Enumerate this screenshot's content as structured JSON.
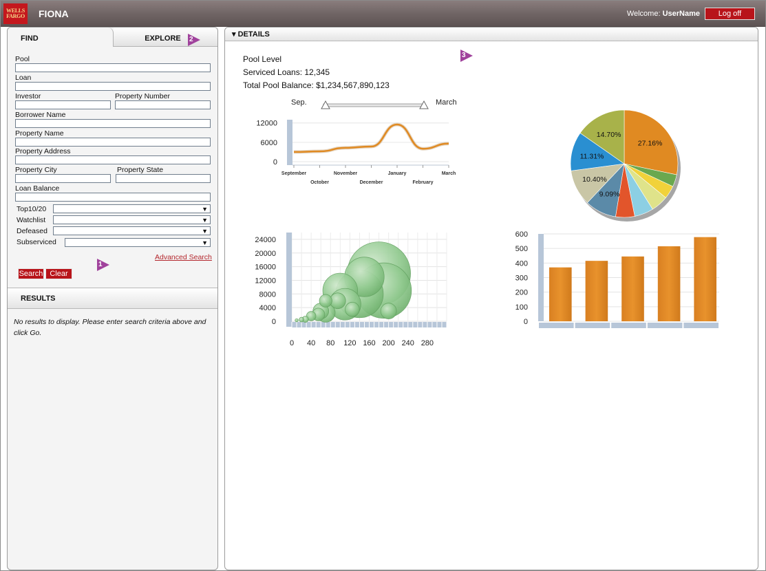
{
  "app": {
    "logo_text_1": "WELLS",
    "logo_text_2": "FARGO",
    "title": "FIONA",
    "welcome_label": "Welcome:",
    "username": "UserName",
    "logoff_label": "Log off"
  },
  "find": {
    "tab_find": "FIND",
    "tab_explore": "EXPLORE",
    "fields": {
      "pool": "Pool",
      "loan": "Loan",
      "investor": "Investor",
      "property_number": "Property Number",
      "borrower_name": "Borrower Name",
      "property_name": "Property Name",
      "property_address": "Property Address",
      "property_city": "Property City",
      "property_state": "Property State",
      "loan_balance": "Loan Balance",
      "top10_20": "Top10/20",
      "watchlist": "Watchlist",
      "defeased": "Defeased",
      "subserviced": "Subserviced"
    },
    "advanced_search": "Advanced Search",
    "search_btn": "Search",
    "clear_btn": "Clear",
    "results_title": "RESULTS",
    "results_message": "No results to display.  Please enter search criteria above and click Go."
  },
  "markers": {
    "m1": "1",
    "m2": "2",
    "m3": "3"
  },
  "details": {
    "header": "▾ DETAILS",
    "pool_level": "Pool Level",
    "serviced_loans": "Serviced Loans:  12,345",
    "total_balance": "Total Pool Balance:  $1,234,567,890,123",
    "slider_start": "Sep.",
    "slider_end": "March"
  },
  "colors": {
    "orange": "#e08a22",
    "brand_red": "#b8141a",
    "axis_blue": "#b7c6d8",
    "bubble_green": "#8fc98e"
  },
  "chart_data": [
    {
      "type": "line",
      "title": "",
      "categories": [
        "September",
        "October",
        "November",
        "December",
        "January",
        "February",
        "March"
      ],
      "series": [
        {
          "values": [
            3000,
            3200,
            4300,
            4700,
            11500,
            4000,
            5600
          ]
        }
      ],
      "yticks": [
        0,
        6000,
        12000
      ],
      "ylim": [
        0,
        13000
      ]
    },
    {
      "type": "pie",
      "title": "",
      "slices": [
        {
          "label": "27.16%",
          "value": 27.16,
          "color": "#e08a22"
        },
        {
          "label": "",
          "value": 3.5,
          "color": "#6aa84f"
        },
        {
          "label": "",
          "value": 3.8,
          "color": "#f1d23a"
        },
        {
          "label": "",
          "value": 5.0,
          "color": "#dfe38a"
        },
        {
          "label": "",
          "value": 5.5,
          "color": "#8ccfe3"
        },
        {
          "label": "",
          "value": 5.5,
          "color": "#e2552b"
        },
        {
          "label": "9.09%",
          "value": 9.09,
          "color": "#5b8aa8"
        },
        {
          "label": "10.40%",
          "value": 10.4,
          "color": "#c9c6a6"
        },
        {
          "label": "11.31%",
          "value": 11.31,
          "color": "#2a8fd1"
        },
        {
          "label": "14.70%",
          "value": 14.7,
          "color": "#a8b24a"
        }
      ]
    },
    {
      "type": "scatter",
      "title": "",
      "xticks": [
        0,
        40,
        80,
        120,
        160,
        200,
        240,
        280
      ],
      "yticks": [
        0,
        4000,
        8000,
        12000,
        16000,
        20000,
        24000
      ],
      "xlim": [
        0,
        320
      ],
      "ylim": [
        0,
        26000
      ],
      "points": [
        {
          "x": 10,
          "y": 300,
          "r": 2
        },
        {
          "x": 20,
          "y": 500,
          "r": 3
        },
        {
          "x": 28,
          "y": 600,
          "r": 4
        },
        {
          "x": 40,
          "y": 1500,
          "r": 6
        },
        {
          "x": 55,
          "y": 2000,
          "r": 8
        },
        {
          "x": 60,
          "y": 3000,
          "r": 10
        },
        {
          "x": 70,
          "y": 2500,
          "r": 12
        },
        {
          "x": 110,
          "y": 5000,
          "r": 20
        },
        {
          "x": 100,
          "y": 9000,
          "r": 22
        },
        {
          "x": 140,
          "y": 8000,
          "r": 30
        },
        {
          "x": 190,
          "y": 9000,
          "r": 35
        },
        {
          "x": 150,
          "y": 13000,
          "r": 25
        },
        {
          "x": 180,
          "y": 14000,
          "r": 40
        },
        {
          "x": 95,
          "y": 6000,
          "r": 10
        },
        {
          "x": 125,
          "y": 3500,
          "r": 9
        },
        {
          "x": 200,
          "y": 3000,
          "r": 10
        },
        {
          "x": 70,
          "y": 6000,
          "r": 8
        }
      ]
    },
    {
      "type": "bar",
      "title": "",
      "categories": [
        "",
        "",
        "",
        "",
        ""
      ],
      "values": [
        370,
        415,
        445,
        515,
        578
      ],
      "yticks": [
        0,
        100,
        200,
        300,
        400,
        500,
        600
      ],
      "ylim": [
        0,
        600
      ]
    }
  ]
}
